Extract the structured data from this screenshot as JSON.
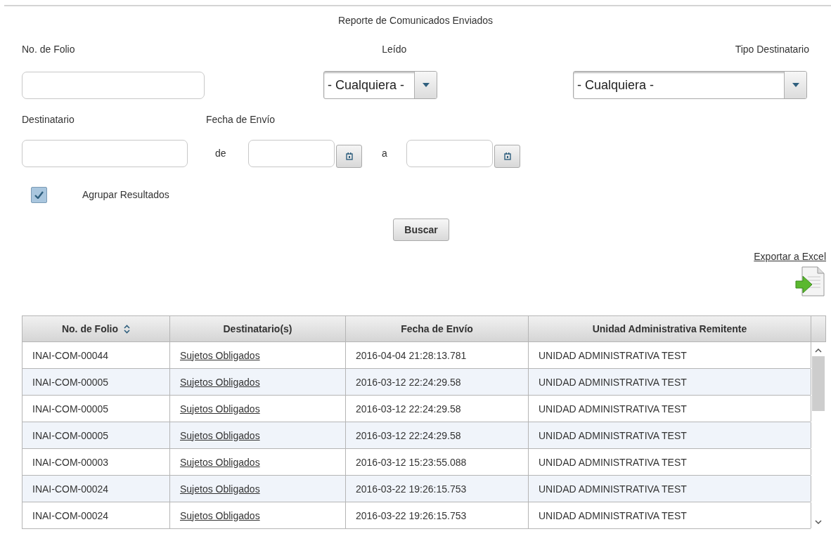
{
  "title": "Reporte de Comunicados Enviados",
  "filters": {
    "folio": {
      "label": "No. de Folio"
    },
    "leido": {
      "label": "Leído",
      "value": "- Cualquiera -"
    },
    "tipo": {
      "label": "Tipo Destinatario",
      "value": "- Cualquiera -"
    },
    "destinatario": {
      "label": "Destinatario"
    },
    "fecha": {
      "label": "Fecha de Envío",
      "from_label": "de",
      "to_label": "a"
    },
    "agrupar": {
      "label": "Agrupar Resultados",
      "checked": true
    },
    "search_button": "Buscar"
  },
  "export": {
    "label": "Exportar a Excel"
  },
  "table": {
    "columns": [
      {
        "label": "No. de Folio",
        "sortable": true
      },
      {
        "label": "Destinatario(s)",
        "sortable": false
      },
      {
        "label": "Fecha de Envío",
        "sortable": false
      },
      {
        "label": "Unidad Administrativa Remitente",
        "sortable": false
      }
    ],
    "rows": [
      {
        "folio": "INAI-COM-00044",
        "destinatario": "Sujetos Obligados",
        "fecha": "2016-04-04 21:28:13.781",
        "unidad": "UNIDAD ADMINISTRATIVA TEST"
      },
      {
        "folio": "INAI-COM-00005",
        "destinatario": "Sujetos Obligados",
        "fecha": "2016-03-12 22:24:29.58",
        "unidad": "UNIDAD ADMINISTRATIVA TEST"
      },
      {
        "folio": "INAI-COM-00005",
        "destinatario": "Sujetos Obligados",
        "fecha": "2016-03-12 22:24:29.58",
        "unidad": "UNIDAD ADMINISTRATIVA TEST"
      },
      {
        "folio": "INAI-COM-00005",
        "destinatario": "Sujetos Obligados",
        "fecha": "2016-03-12 22:24:29.58",
        "unidad": "UNIDAD ADMINISTRATIVA TEST"
      },
      {
        "folio": "INAI-COM-00003",
        "destinatario": "Sujetos Obligados",
        "fecha": "2016-03-12 15:23:55.088",
        "unidad": "UNIDAD ADMINISTRATIVA TEST"
      },
      {
        "folio": "INAI-COM-00024",
        "destinatario": "Sujetos Obligados",
        "fecha": "2016-03-22 19:26:15.753",
        "unidad": "UNIDAD ADMINISTRATIVA TEST"
      },
      {
        "folio": "INAI-COM-00024",
        "destinatario": "Sujetos Obligados",
        "fecha": "2016-03-22 19:26:15.753",
        "unidad": "UNIDAD ADMINISTRATIVA TEST"
      }
    ]
  }
}
